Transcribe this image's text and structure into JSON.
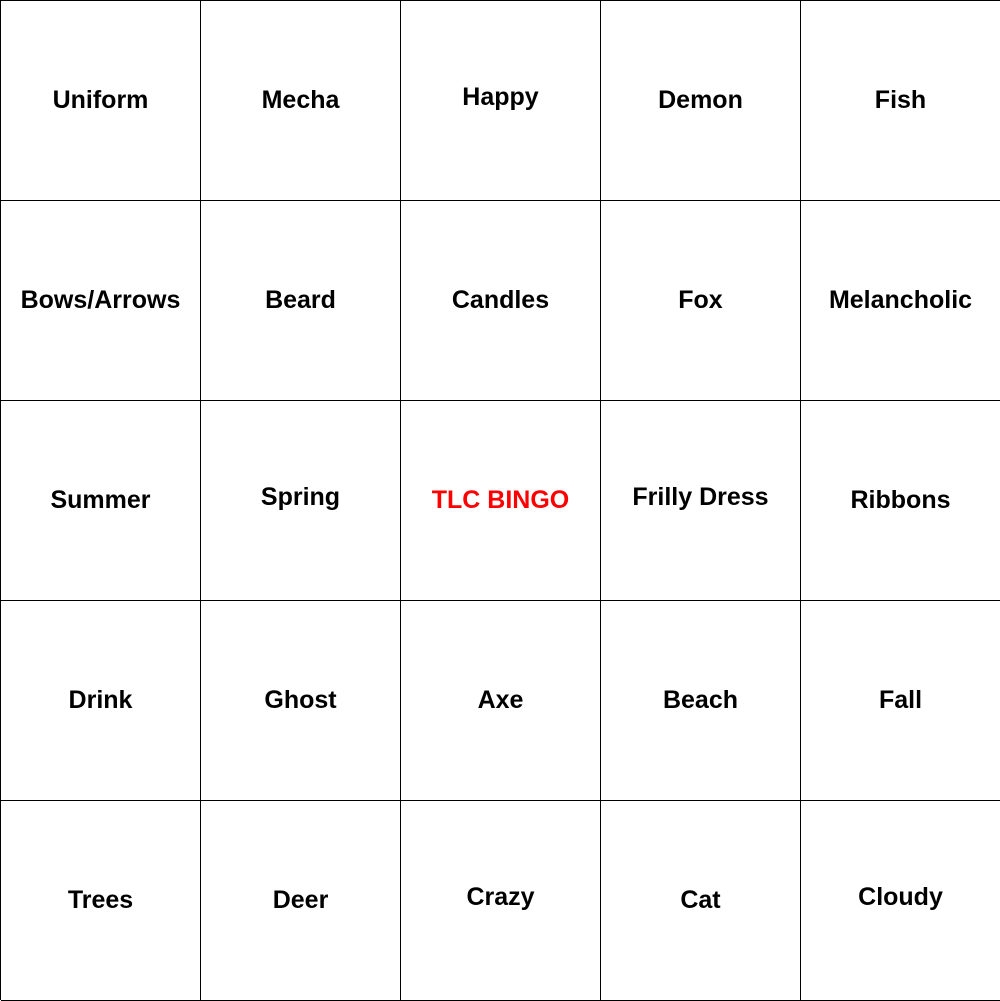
{
  "board": {
    "free_color": "#ff0000",
    "cells": [
      "Uniform",
      "Mecha",
      "Happy",
      "Demon",
      "Fish",
      "Bows/Arrows",
      "Beard",
      "Candles",
      "Fox",
      "Melancholic",
      "Summer",
      "Spring",
      "TLC BINGO",
      "Frilly Dress",
      "Ribbons",
      "Drink",
      "Ghost",
      "Axe",
      "Beach",
      "Fall",
      "Trees",
      "Deer",
      "Crazy",
      "Cat",
      "Cloudy"
    ]
  }
}
